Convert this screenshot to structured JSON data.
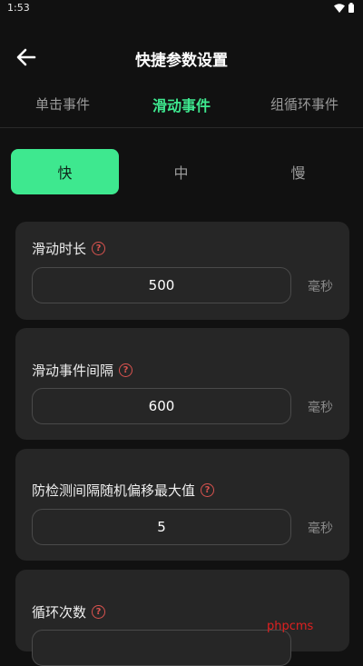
{
  "status": {
    "time": "1:53"
  },
  "header": {
    "title": "快捷参数设置"
  },
  "tabs": [
    {
      "label": "单击事件"
    },
    {
      "label": "滑动事件"
    },
    {
      "label": "组循环事件"
    }
  ],
  "speed_options": [
    {
      "label": "快"
    },
    {
      "label": "中"
    },
    {
      "label": "慢"
    }
  ],
  "params": [
    {
      "label": "滑动时长",
      "value": "500",
      "unit": "毫秒"
    },
    {
      "label": "滑动事件间隔",
      "value": "600",
      "unit": "毫秒"
    },
    {
      "label": "防检测间隔随机偏移最大值",
      "value": "5",
      "unit": "毫秒"
    },
    {
      "label": "循环次数",
      "value": "",
      "unit": ""
    }
  ],
  "help_glyph": "?",
  "watermark": "phpcms",
  "colors": {
    "accent": "#3ee88f",
    "help": "#d9534f",
    "background": "#111111",
    "card": "#262626"
  }
}
